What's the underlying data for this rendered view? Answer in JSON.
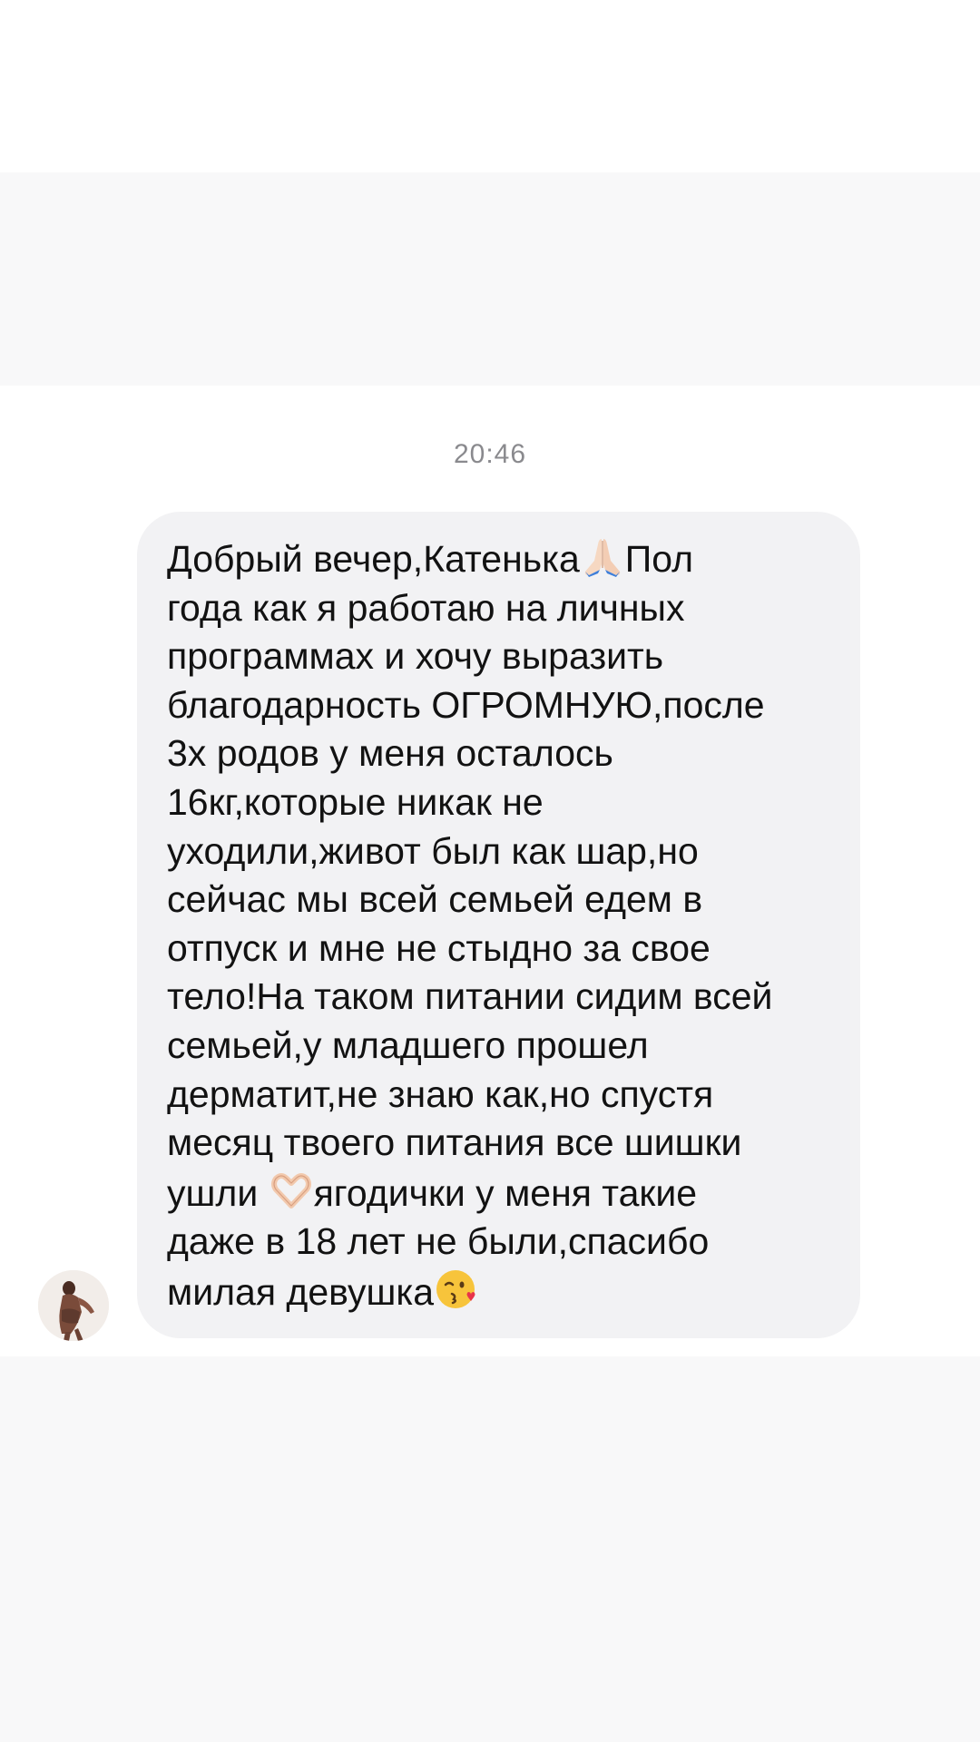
{
  "timestamp": "20:46",
  "message": {
    "lines": [
      "Добрый вечер,Катенька",
      "Пол",
      "года как я работаю на личных",
      "программах и хочу выразить",
      "благодарность ОГРОМНУЮ,после",
      "3х родов у меня осталось",
      "16кг,которые никак не",
      "уходили,живот был как шар,но",
      "сейчас мы всей семьей едем в",
      "отпуск и мне не стыдно за свое",
      "тело!На таком питании сидим всей",
      "семьей,у младшего прошел",
      "дерматит,не знаю как,но спустя",
      "месяц твоего питания все шишки",
      "ушли ",
      "ягодички у меня такие",
      "даже в 18 лет не были,спасибо",
      "милая девушка"
    ],
    "emojis": [
      "folded-hands-emoji",
      "heart-hands-emoji",
      "face-blowing-kiss-emoji"
    ]
  },
  "colors": {
    "bubble": "#f2f2f4",
    "text": "#121212",
    "timestamp": "#8a8a8e",
    "band": "#f8f8f9"
  }
}
